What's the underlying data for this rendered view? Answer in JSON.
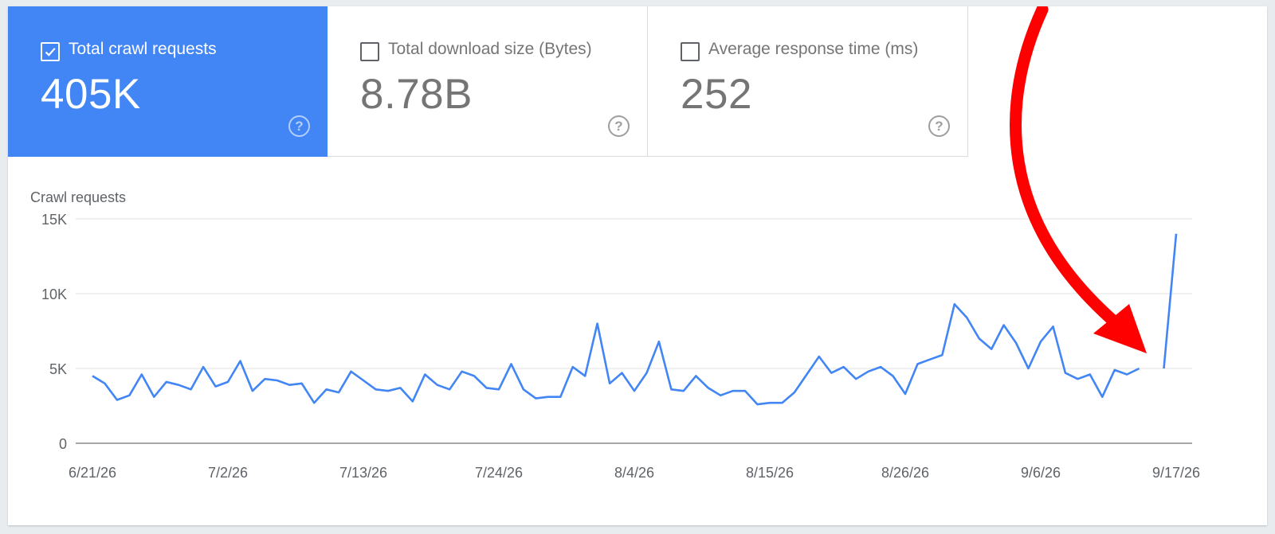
{
  "metrics": [
    {
      "label": "Total crawl requests",
      "value": "405K",
      "checked": true
    },
    {
      "label": "Total download size (Bytes)",
      "value": "8.78B",
      "checked": false
    },
    {
      "label": "Average response time (ms)",
      "value": "252",
      "checked": false
    }
  ],
  "help_glyph": "?",
  "colors": {
    "accent": "#4285f4",
    "line": "#4285f4",
    "arrow": "#ff0000",
    "grid": "#e0e0e0"
  },
  "annotation": {
    "shape": "red-curved-arrow",
    "points_to": "9/15/26"
  },
  "chart_data": {
    "type": "line",
    "title": "Crawl requests",
    "xlabel": "",
    "ylabel": "",
    "ylim": [
      0,
      15000
    ],
    "yticks": [
      0,
      5000,
      10000,
      15000
    ],
    "ytick_labels": [
      "0",
      "5K",
      "10K",
      "15K"
    ],
    "xticks": [
      "6/21/26",
      "7/2/26",
      "7/13/26",
      "7/24/26",
      "8/4/26",
      "8/15/26",
      "8/26/26",
      "9/6/26",
      "9/17/26"
    ],
    "x_start": "6/21/26",
    "x_end": "9/17/26",
    "grid": true,
    "legend": "none",
    "series": [
      {
        "values": [
          4500,
          4000,
          2900,
          3200,
          4600,
          3100,
          4100,
          3900,
          3600,
          5100,
          3800,
          4100,
          5500,
          3500,
          4300,
          4200,
          3900,
          4000,
          2700,
          3600,
          3400,
          4800,
          4200,
          3600,
          3500,
          3700,
          2800,
          4600,
          3900,
          3600,
          4800,
          4500,
          3700,
          3600,
          5300,
          3600,
          3000,
          3100,
          3100,
          5100,
          4500,
          8000,
          4000,
          4700,
          3500,
          4700,
          6800,
          3600,
          3500,
          4500,
          3700,
          3200,
          3500,
          3500,
          2600,
          2700,
          2700,
          3400,
          4600,
          5800,
          4700,
          5100,
          4300,
          4800,
          5100,
          4500,
          3300,
          5300,
          5600,
          5900,
          9300,
          8400,
          7000,
          6300,
          7900,
          6700,
          5000,
          6800,
          7800,
          4700,
          4300,
          4600,
          3100,
          4900,
          4600,
          5000,
          null,
          5000,
          14000
        ]
      }
    ]
  }
}
